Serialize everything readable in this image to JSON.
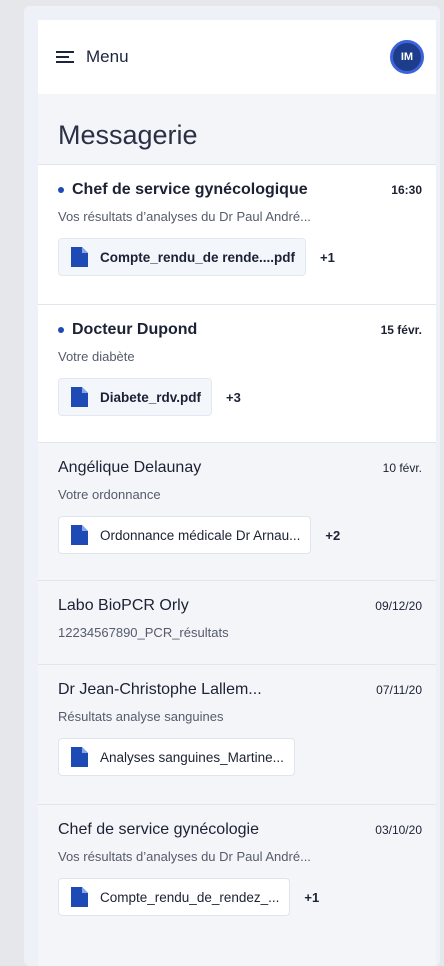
{
  "header": {
    "menu_label": "Menu",
    "avatar_initials": "IM"
  },
  "page_title": "Messagerie",
  "colors": {
    "accent": "#1e4ab5",
    "avatar": "#1e3c8c",
    "unread_bg": "#ffffff",
    "read_bg": "#f3f5f9"
  },
  "messages": [
    {
      "sender": "Chef de service gynécologique",
      "date": "16:30",
      "subject": "Vos résultats d’analyses du Dr Paul André...",
      "attachment": "Compte_rendu_de rende....pdf",
      "more": "+1",
      "unread": true
    },
    {
      "sender": "Docteur Dupond",
      "date": "15 févr.",
      "subject": "Votre diabète",
      "attachment": "Diabete_rdv.pdf",
      "more": "+3",
      "unread": true
    },
    {
      "sender": "Angélique Delaunay",
      "date": "10 févr.",
      "subject": "Votre ordonnance",
      "attachment": "Ordonnance médicale Dr Arnau...",
      "more": "+2",
      "unread": false
    },
    {
      "sender": "Labo BioPCR Orly",
      "date": "09/12/20",
      "subject": "12234567890_PCR_résultats",
      "attachment": "",
      "more": "",
      "unread": false
    },
    {
      "sender": "Dr Jean-Christophe Lallem...",
      "date": "07/11/20",
      "subject": "Résultats analyse sanguines",
      "attachment": "Analyses sanguines_Martine...",
      "more": "",
      "unread": false
    },
    {
      "sender": "Chef de service gynécologie",
      "date": "03/10/20",
      "subject": "Vos résultats d’analyses du Dr Paul André...",
      "attachment": "Compte_rendu_de_rendez_...",
      "more": "+1",
      "unread": false
    }
  ]
}
